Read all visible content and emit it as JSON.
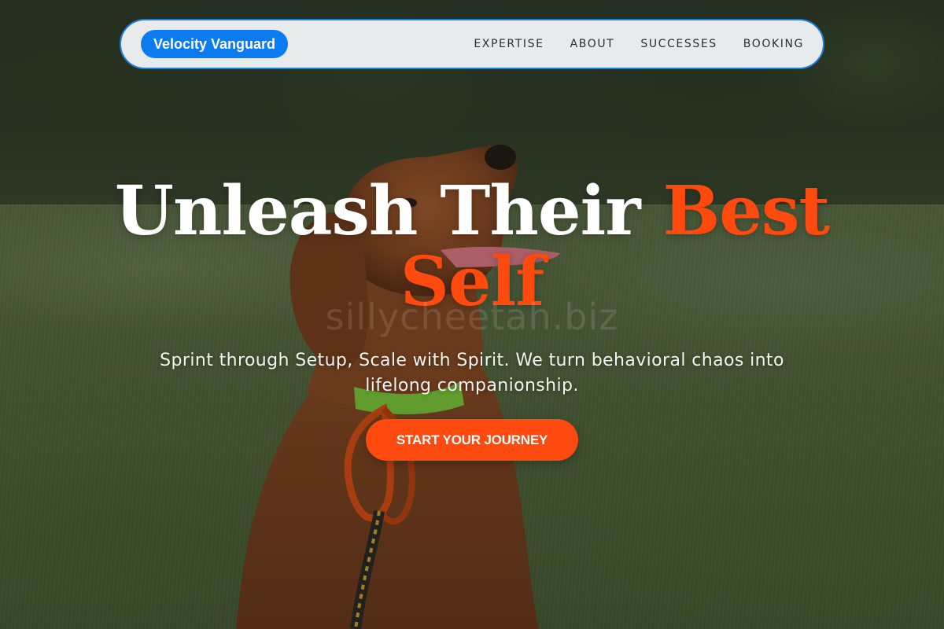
{
  "nav": {
    "brand": "Velocity Vanguard",
    "links": [
      "EXPERTISE",
      "ABOUT",
      "SUCCESSES",
      "BOOKING"
    ]
  },
  "hero": {
    "title_main": "Unleash Their ",
    "title_accent": "Best Self",
    "subtitle": "Sprint through Setup, Scale with Spirit. We turn behavioral chaos into lifelong companionship.",
    "cta_label": "START YOUR JOURNEY"
  },
  "watermark": "sillycheetah.biz",
  "colors": {
    "accent": "#ff4a0f",
    "brand_blue": "#0b7bef",
    "nav_border": "#1b7fe0",
    "nav_bg": "#f0f2f4"
  }
}
